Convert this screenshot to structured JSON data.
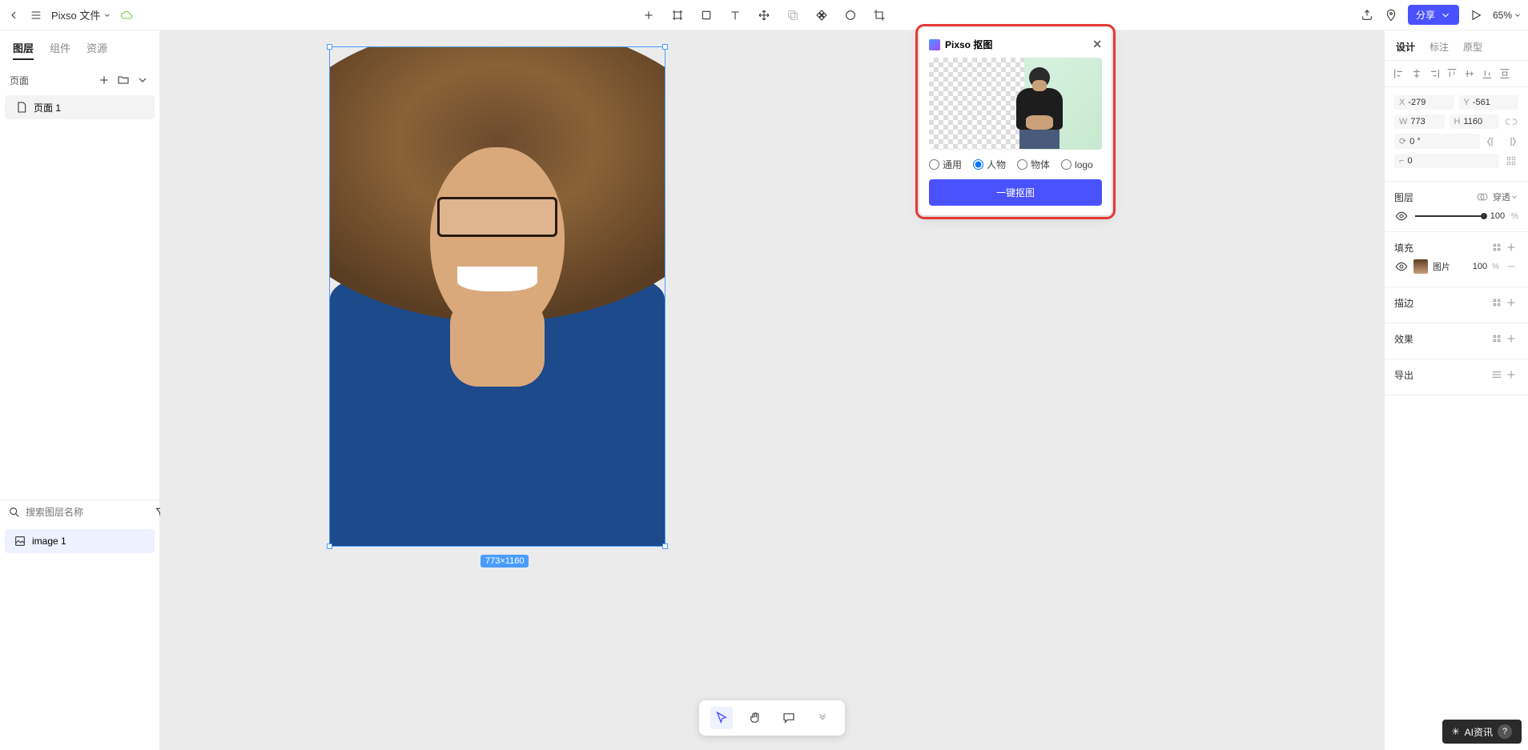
{
  "topbar": {
    "file_title": "Pixso 文件",
    "share": "分享",
    "zoom": "65%"
  },
  "left_panel": {
    "tabs": [
      "图层",
      "组件",
      "资源"
    ],
    "pages_label": "页面",
    "page1": "页面 1",
    "search_placeholder": "搜索图层名称",
    "layer1": "image 1"
  },
  "canvas": {
    "dimensions_badge": "773×1160"
  },
  "cutout_panel": {
    "title": "Pixso 抠图",
    "radio_general": "通用",
    "radio_person": "人物",
    "radio_object": "物体",
    "radio_logo": "logo",
    "action_btn": "一键抠图"
  },
  "right_panel": {
    "tabs": [
      "设计",
      "标注",
      "原型"
    ],
    "x": "-279",
    "y": "-561",
    "w": "773",
    "h": "1160",
    "rotation": "0 °",
    "radius": "0",
    "layer_section": "图层",
    "passthrough": "穿透",
    "opacity": "100",
    "pct": "%",
    "fill_section": "填充",
    "fill_type": "图片",
    "fill_opacity": "100",
    "stroke_section": "描边",
    "effect_section": "效果",
    "export_section": "导出"
  },
  "watermark": {
    "text": "AI资讯"
  }
}
